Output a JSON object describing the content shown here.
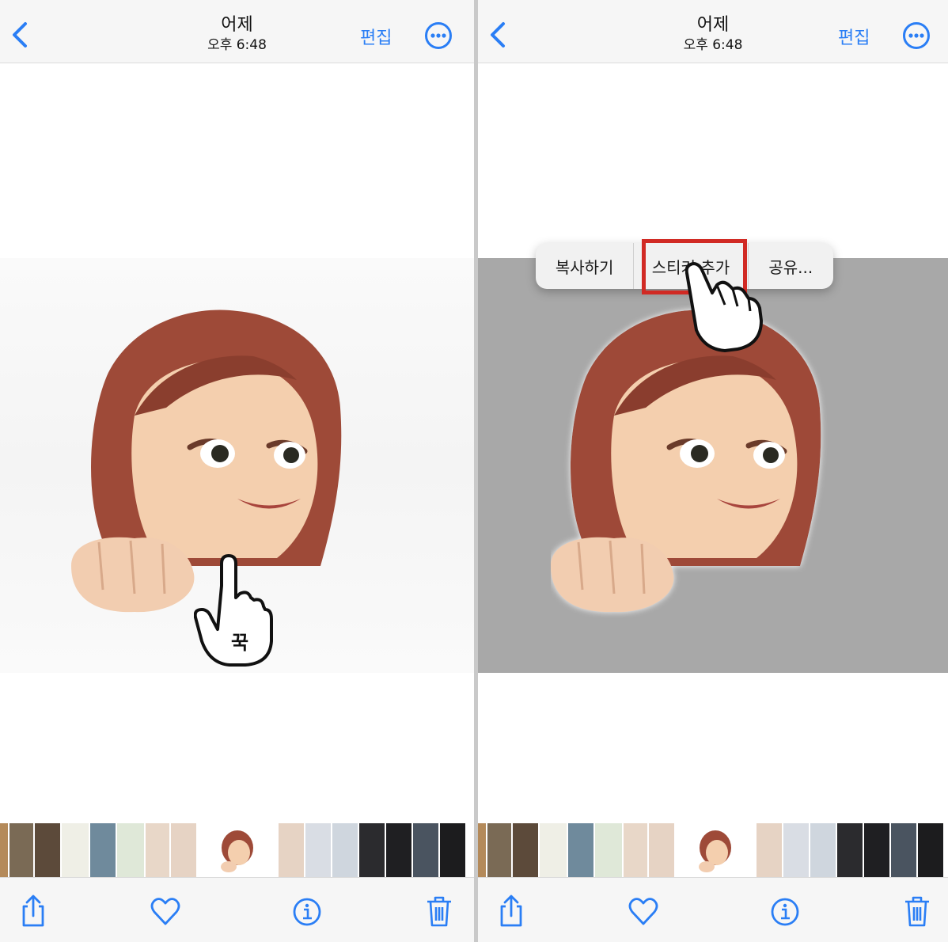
{
  "header": {
    "title": "어제",
    "subtitle": "오후 6:48",
    "edit_label": "편집"
  },
  "context_menu": {
    "items": [
      "복사하기",
      "스티커 추가",
      "공유..."
    ]
  },
  "gesture": {
    "label": "꾹"
  },
  "icons": {
    "back": "chevron-left-icon",
    "more": "ellipsis-circle-icon",
    "share": "share-icon",
    "favorite": "heart-icon",
    "info": "info-icon",
    "delete": "trash-icon"
  },
  "colors": {
    "accent": "#2a7ef5",
    "highlight": "#d12a24",
    "lifted_background": "#a8a8a8"
  }
}
